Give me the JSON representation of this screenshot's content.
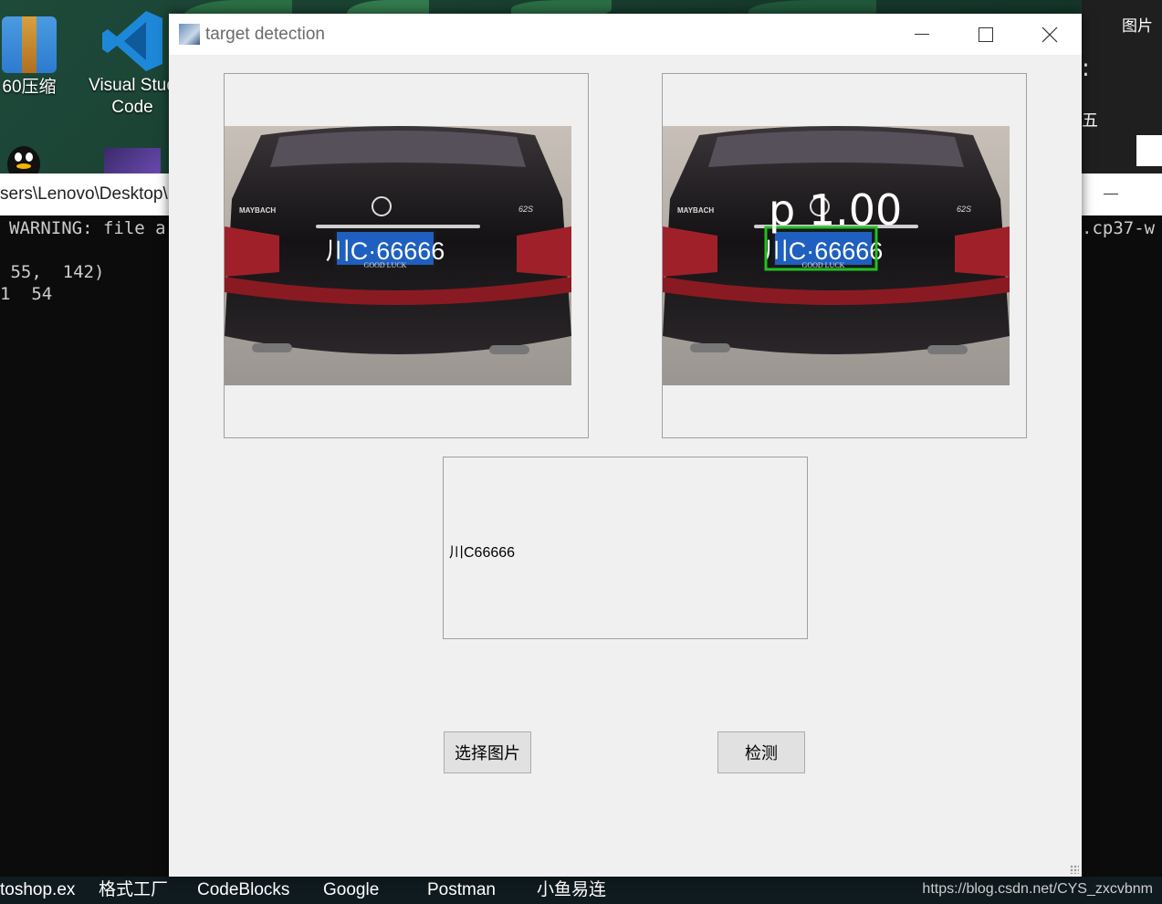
{
  "desktop": {
    "icons": [
      {
        "label": "60压缩"
      },
      {
        "label_line1": "Visual Stud",
        "label_line2": "Code"
      }
    ]
  },
  "terminal": {
    "path": "sers\\Lenovo\\Desktop\\",
    "lines": [
      "WARNING: file a",
      " 55,  142)",
      "1  54"
    ],
    "right_text": ".cp37-w"
  },
  "right_panel": {
    "label": "图片",
    "chars": [
      ":",
      "五"
    ]
  },
  "taskbar": {
    "items": [
      "toshop.ex",
      "格式工厂",
      "CodeBlocks",
      "Google",
      "Postman",
      "小鱼易连"
    ],
    "watermark": "https://blog.csdn.net/CYS_zxcvbnm"
  },
  "window": {
    "title": "target detection",
    "input_image_label": "MAYBACH",
    "plate_text": "川C·66666",
    "plate_sub": "GOOD LUCK",
    "badge": "62S",
    "detection_label": "p 1.00",
    "result_text": "川C66666",
    "buttons": {
      "select": "选择图片",
      "detect": "检测"
    }
  },
  "colors": {
    "accent_box": "#22c022",
    "plate_blue": "#1f5fc0",
    "window_bg": "#f0f0f0"
  }
}
